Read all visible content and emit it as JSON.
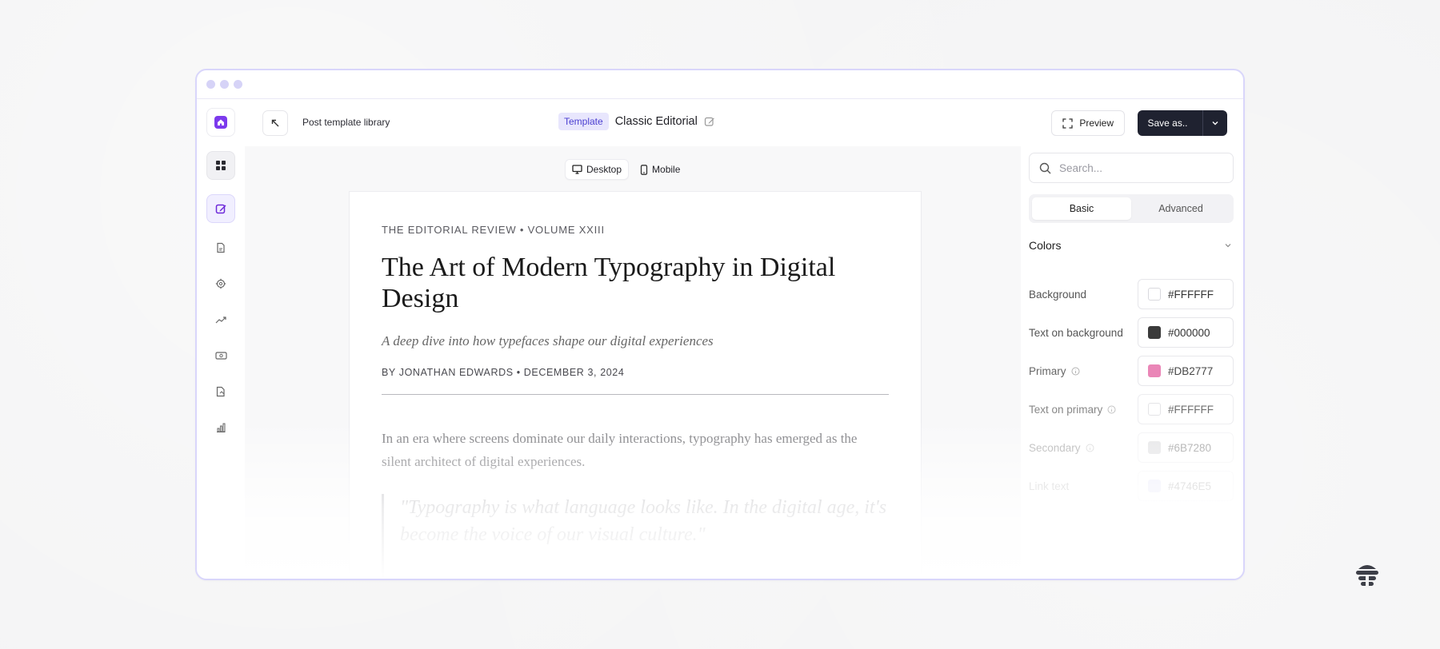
{
  "app": {
    "breadcrumb": "Post template library",
    "badge": "Template",
    "doc_title": "Classic Editorial",
    "preview_label": "Preview",
    "save_label": "Save as..",
    "device": {
      "desktop": "Desktop",
      "mobile": "Mobile",
      "selected": "Desktop"
    }
  },
  "icons": {
    "rail": [
      "grid-icon",
      "edit-icon",
      "file-icon",
      "settings-icon",
      "trend-icon",
      "dollar-icon",
      "file-image-icon",
      "chart-icon"
    ],
    "logo": "home-icon"
  },
  "article": {
    "kicker": "THE EDITORIAL REVIEW • VOLUME XXIII",
    "headline": "The Art of Modern Typography in Digital Design",
    "dek": "A deep dive into how typefaces shape our digital experiences",
    "byline": "BY JONATHAN EDWARDS • DECEMBER 3, 2024",
    "body": "In an era where screens dominate our daily interactions, typography has emerged as the silent architect of digital experiences.",
    "quote": "\"Typography is what language looks like. In the digital age, it's become the voice of our visual culture.\""
  },
  "panel": {
    "search_placeholder": "Search...",
    "tabs": {
      "basic": "Basic",
      "advanced": "Advanced",
      "selected": "Basic"
    },
    "section_title": "Colors",
    "colors": [
      {
        "label": "Background",
        "value": "#FFFFFF",
        "swatch": "#FFFFFF",
        "info": false
      },
      {
        "label": "Text on background",
        "value": "#000000",
        "swatch": "#3a3a3a",
        "info": false
      },
      {
        "label": "Primary",
        "value": "#DB2777",
        "swatch": "#e879b0",
        "info": true
      },
      {
        "label": "Text on primary",
        "value": "#FFFFFF",
        "swatch": "#FFFFFF",
        "info": true
      },
      {
        "label": "Secondary",
        "value": "#6B7280",
        "swatch": "#c9c9cd",
        "info": true
      },
      {
        "label": "Link text",
        "value": "#4746E5",
        "swatch": "#c9c8f4",
        "info": false
      }
    ]
  },
  "theme": {
    "accent": "#7c3aed",
    "window_border": "#d9d6fb",
    "save_bg": "#1f2230"
  }
}
